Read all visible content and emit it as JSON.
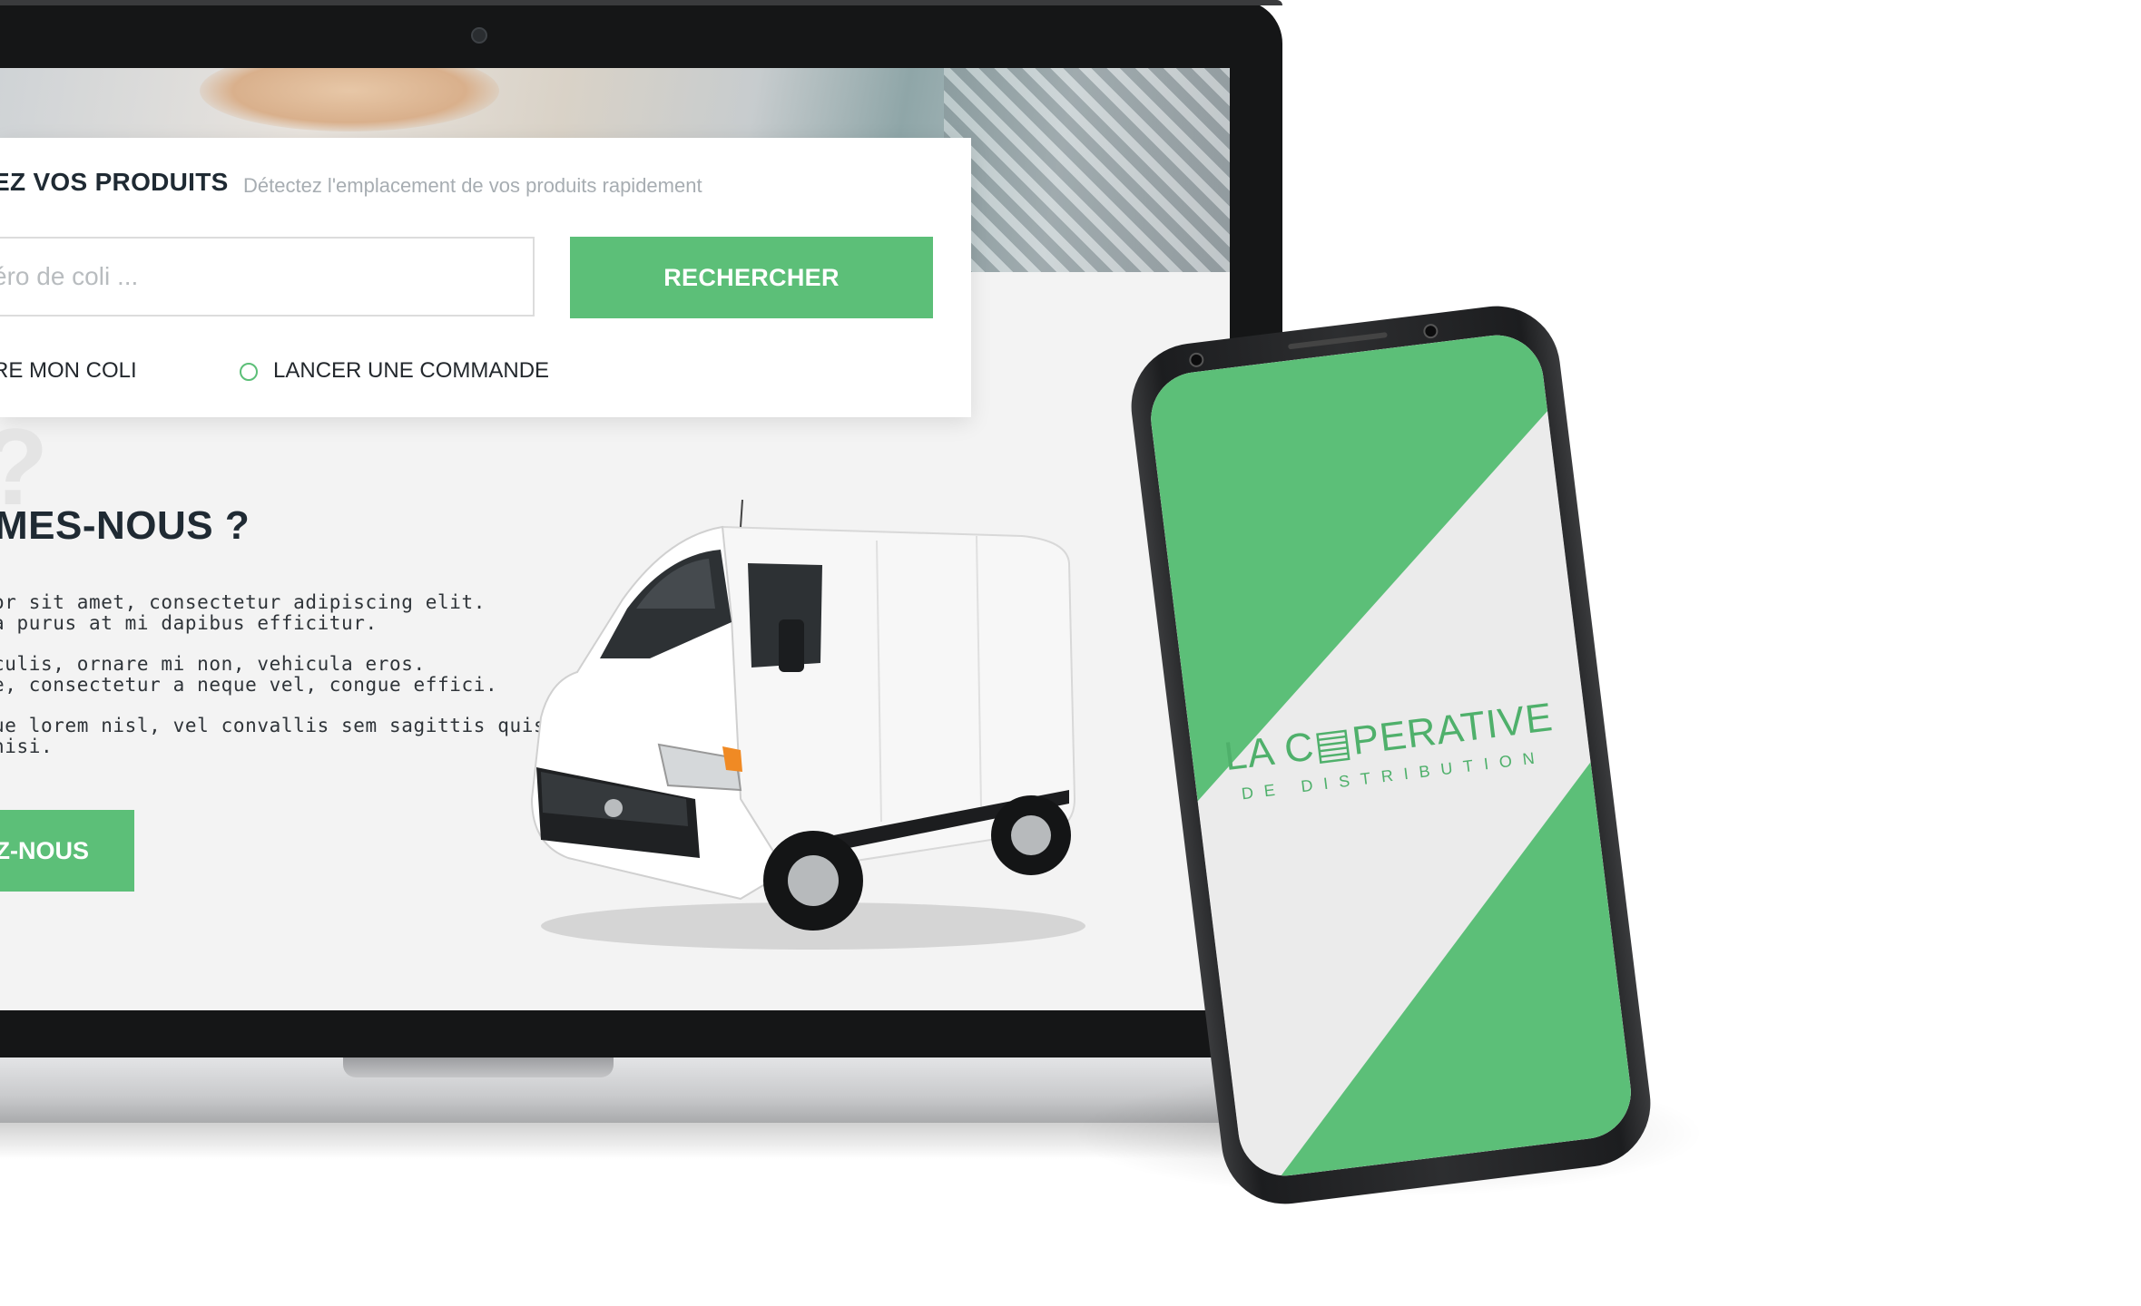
{
  "search_card": {
    "title": "EZ VOS PRODUITS",
    "subtitle": "Détectez l'emplacement de vos produits rapidement",
    "input_placeholder": "éro de coli ...",
    "search_button_label": "RECHERCHER",
    "option_1_label": "RE MON COLI",
    "option_2_label": "LANCER UNE COMMANDE"
  },
  "about": {
    "title": "MES-NOUS ?",
    "paragraphs": [
      [
        "or sit amet, consectetur adipiscing elit.",
        "a purus at mi dapibus efficitur."
      ],
      [
        "culis, ornare mi non, vehicula eros.",
        "e, consectetur a neque vel, congue effici."
      ],
      [
        "ue lorem nisl, vel convallis sem sagittis quis",
        "nisi."
      ]
    ],
    "cta_label": "Z-NOUS"
  },
  "phone": {
    "logo_main": "LA C▤PERATIVE",
    "logo_sub": "DE DISTRIBUTION"
  },
  "colors": {
    "accent_green": "#5cbf78",
    "dark_text": "#1f2a33",
    "laptop_frame": "#151617"
  },
  "icons": {
    "radio": "radio-button-icon",
    "van": "delivery-van-icon",
    "webcam": "webcam-icon"
  }
}
